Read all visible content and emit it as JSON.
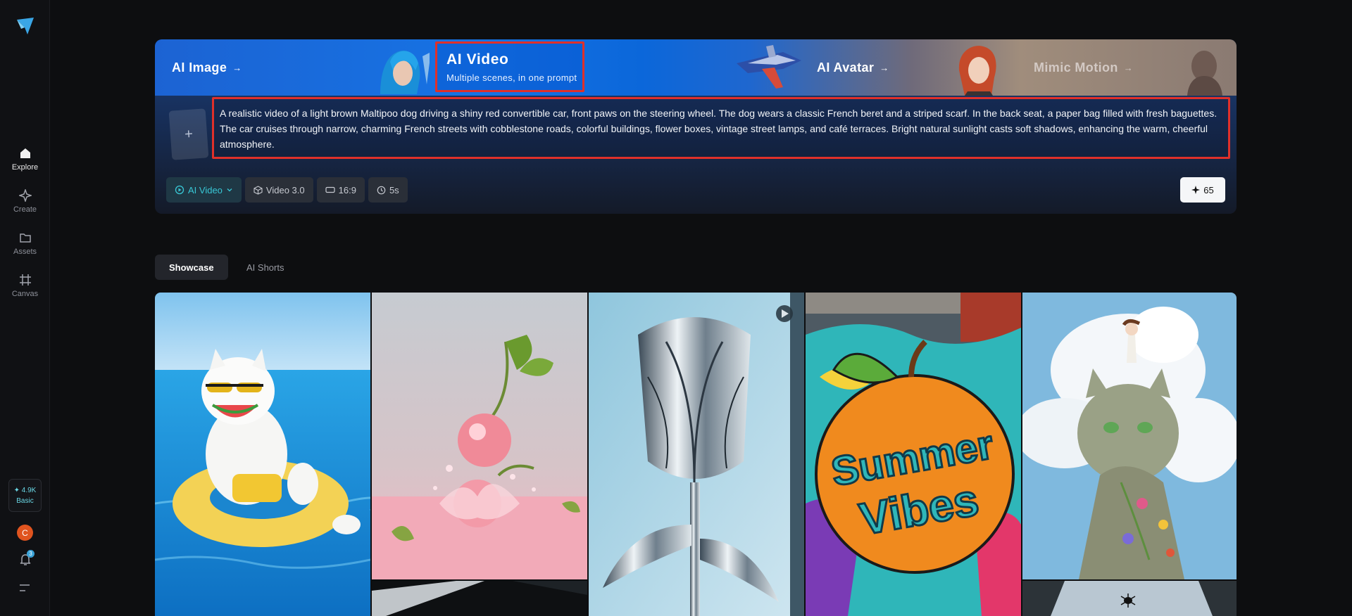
{
  "sidebar": {
    "nav": [
      {
        "label": "Explore"
      },
      {
        "label": "Create"
      },
      {
        "label": "Assets"
      },
      {
        "label": "Canvas"
      }
    ],
    "credits": {
      "amount": "✦ 4.9K",
      "plan": "Basic"
    },
    "avatar_initial": "C",
    "notification_count": "3"
  },
  "hero": {
    "tabs": {
      "image": "AI Image",
      "video": "AI Video",
      "video_subtitle": "Multiple scenes, in one prompt",
      "avatar": "AI Avatar",
      "mimic": "Mimic Motion",
      "arrow": "→"
    },
    "upload_icon": "+",
    "prompt": "A realistic video of a light brown Maltipoo dog driving a shiny red convertible car, front paws on the steering wheel. The dog wears a classic French beret and a striped scarf. In the back seat, a paper bag filled with fresh baguettes. The car cruises through narrow, charming French streets with cobblestone roads, colorful buildings, flower boxes, vintage street lamps, and café terraces. Bright natural sunlight casts soft shadows, enhancing the warm, cheerful atmosphere.",
    "options": {
      "mode": "AI Video",
      "model": "Video 3.0",
      "ratio": "16:9",
      "duration": "5s"
    },
    "generate_cost": "65"
  },
  "sections": {
    "showcase": "Showcase",
    "shorts": "AI Shorts"
  },
  "gallery": [
    {
      "subject": "cat-in-pool"
    },
    {
      "subject": "cherries-splash"
    },
    {
      "subject": "chrome-tulip"
    },
    {
      "subject": "summer-vibes-orange"
    },
    {
      "subject": "cat-clouds-girl"
    }
  ],
  "gallery_text": {
    "line1": "Summer",
    "line2": "Vibes"
  },
  "colors": {
    "accent": "#38c8d6",
    "highlight": "#e0302a",
    "brand": "#1673e4"
  }
}
